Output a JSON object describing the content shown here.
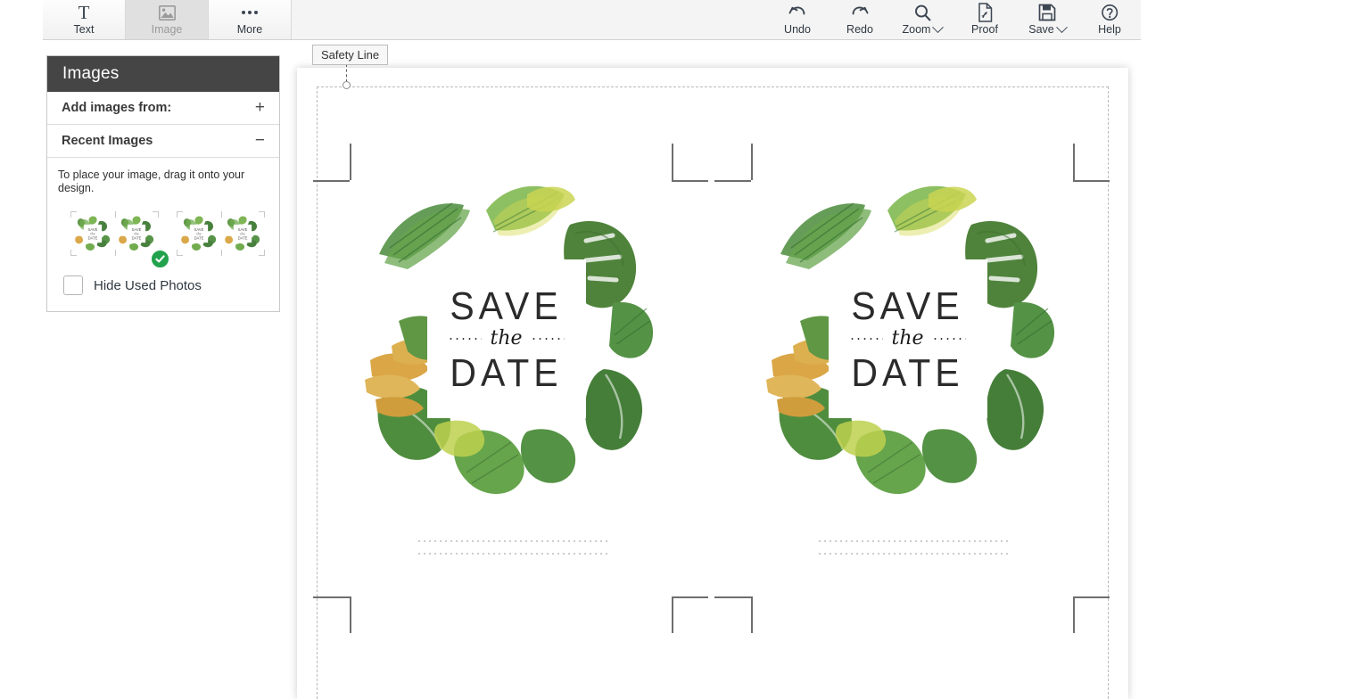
{
  "toolbar": {
    "tabs": [
      {
        "label": "Text",
        "icon": "text-icon",
        "active": false
      },
      {
        "label": "Image",
        "icon": "image-icon",
        "active": true
      },
      {
        "label": "More",
        "icon": "more-dots-icon",
        "active": false
      }
    ],
    "actions": [
      {
        "label": "Undo",
        "icon": "undo-arrow-icon",
        "caret": false
      },
      {
        "label": "Redo",
        "icon": "redo-arrow-icon",
        "caret": false
      },
      {
        "label": "Zoom",
        "icon": "magnifier-icon",
        "caret": true
      },
      {
        "label": "Proof",
        "icon": "pdf-document-icon",
        "caret": false
      },
      {
        "label": "Save",
        "icon": "floppy-disk-icon",
        "caret": true
      },
      {
        "label": "Help",
        "icon": "question-circle-icon",
        "caret": false
      }
    ]
  },
  "sidebar": {
    "title": "Images",
    "add_images_label": "Add images from:",
    "add_images_sign": "+",
    "recent_images_label": "Recent Images",
    "recent_images_sign": "−",
    "hint": "To place your image, drag it onto your design.",
    "thumbnails": [
      {
        "name": "save-the-date-tropical-thumb",
        "selected": true
      },
      {
        "name": "save-the-date-tropical-thumb",
        "selected": false
      }
    ],
    "selected_badge": "✓",
    "hide_used_photos_label": "Hide Used Photos",
    "hide_used_photos_checked": false
  },
  "canvas": {
    "safety_line_label": "Safety Line",
    "cards": [
      {
        "save": "SAVE",
        "the": "the",
        "date": "DATE"
      },
      {
        "save": "SAVE",
        "the": "the",
        "date": "DATE"
      }
    ]
  },
  "colors": {
    "toolbar_bg": "#f4f4f4",
    "panel_header_bg": "#454545",
    "accent_green": "#22a24c",
    "safety_line": "#b9b9b9",
    "crop_mark": "#6e6e6e",
    "leaf_green": "#4f8f3f",
    "leaf_gold": "#d9a441"
  }
}
